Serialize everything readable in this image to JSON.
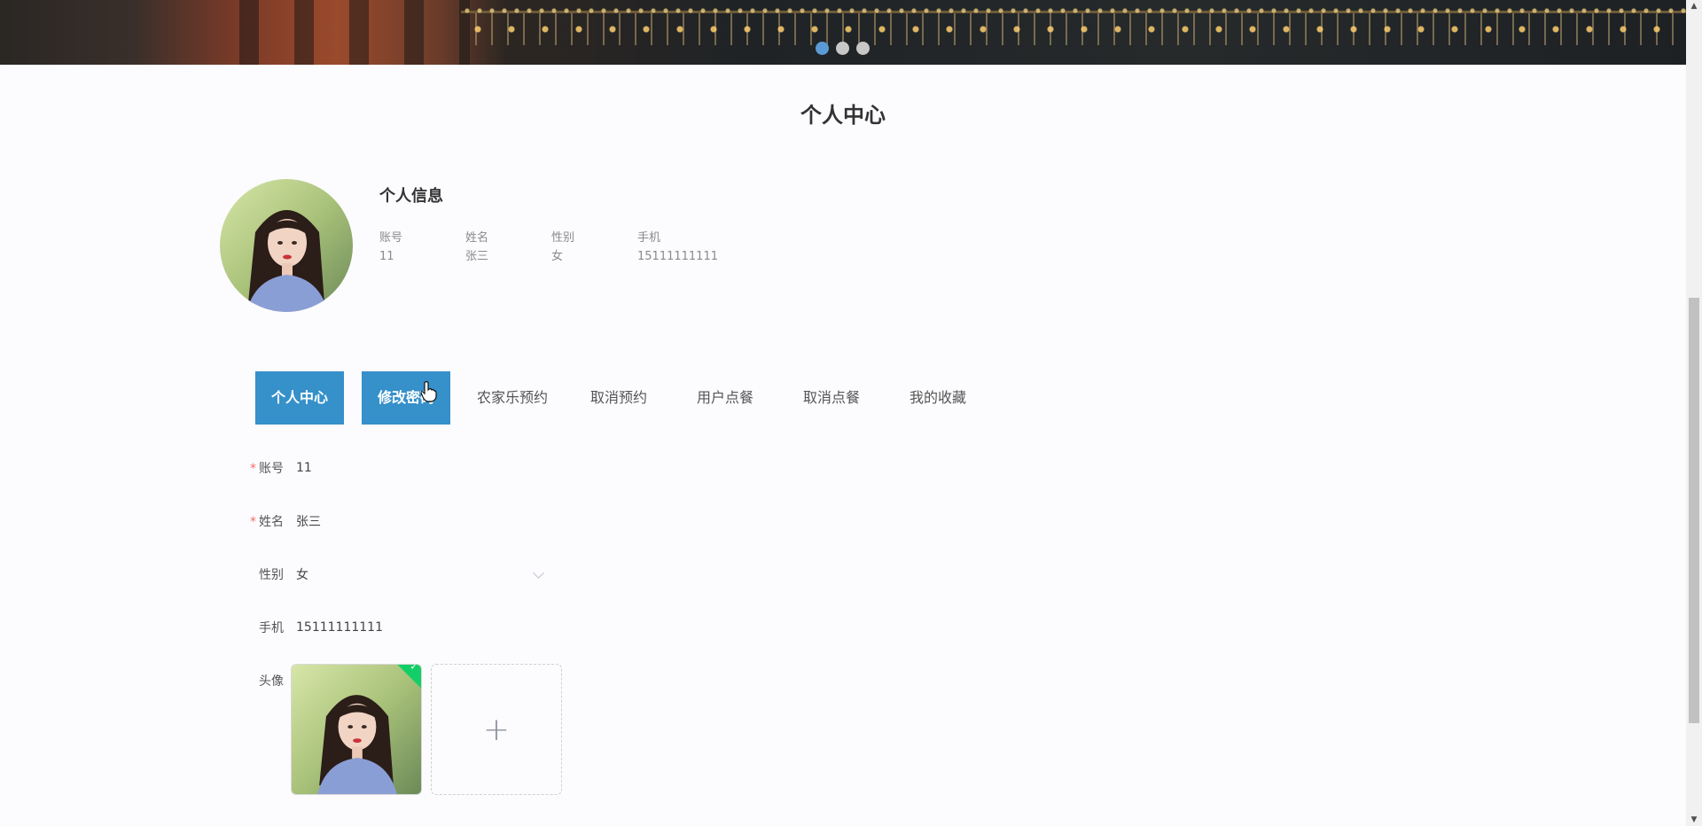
{
  "carousel": {
    "dots": 3,
    "active_index": 0
  },
  "page_title": "个人中心",
  "profile": {
    "section_title": "个人信息",
    "fields": [
      {
        "label": "账号",
        "value": "11"
      },
      {
        "label": "姓名",
        "value": "张三"
      },
      {
        "label": "性别",
        "value": "女"
      },
      {
        "label": "手机",
        "value": "15111111111"
      }
    ]
  },
  "tabs": [
    {
      "label": "个人中心",
      "state": "active"
    },
    {
      "label": "修改密码",
      "state": "hover"
    },
    {
      "label": "农家乐预约",
      "state": "normal"
    },
    {
      "label": "取消预约",
      "state": "normal"
    },
    {
      "label": "用户点餐",
      "state": "normal"
    },
    {
      "label": "取消点餐",
      "state": "normal"
    },
    {
      "label": "我的收藏",
      "state": "normal"
    }
  ],
  "form": {
    "account": {
      "label": "账号",
      "required": true,
      "value": "11"
    },
    "name": {
      "label": "姓名",
      "required": true,
      "value": "张三"
    },
    "gender": {
      "label": "性别",
      "required": false,
      "value": "女"
    },
    "phone": {
      "label": "手机",
      "required": false,
      "value": "15111111111"
    },
    "avatar": {
      "label": "头像",
      "required": false
    }
  },
  "colors": {
    "accent": "#3690c9",
    "required_star": "#f56c6c",
    "upload_success": "#13ce66",
    "carousel_active": "#5b9bd5"
  },
  "icons": {
    "tab_cursor": "hand-pointer-icon",
    "upload_add": "plus-icon",
    "upload_success": "check-icon",
    "select": "chevron-down-icon"
  }
}
